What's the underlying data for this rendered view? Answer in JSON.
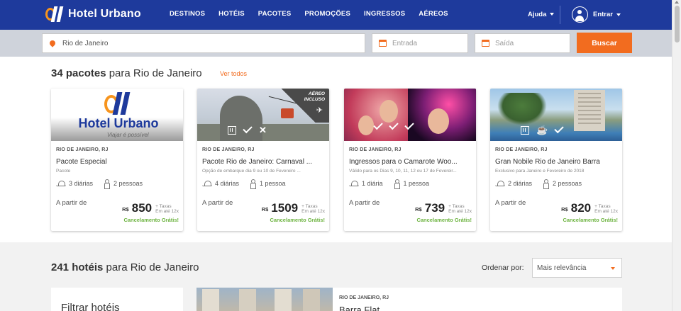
{
  "header": {
    "brand": "Hotel Urbano",
    "nav": [
      "DESTINOS",
      "HOTÉIS",
      "PACOTES",
      "PROMOÇÕES",
      "INGRESSOS",
      "AÉREOS"
    ],
    "help": "Ajuda",
    "login": "Entrar"
  },
  "search": {
    "destination": "Rio de Janeiro",
    "checkin_placeholder": "Entrada",
    "checkout_placeholder": "Saída",
    "button": "Buscar"
  },
  "packages": {
    "count": "34 pacotes",
    "title_rest": " para Rio de Janeiro",
    "see_all": "Ver todos",
    "cards": [
      {
        "location": "RIO DE JANEIRO, RJ",
        "title": "Pacote Especial",
        "subtitle": "Pacote",
        "nights": "3 diárias",
        "people": "2 pessoas",
        "from": "A partir de",
        "currency": "R$",
        "price": "850",
        "tax1": "+ Taxas",
        "tax2": "Em até 12x",
        "cancel": "Cancelamento Grátis!",
        "logo_name": "Hotel Urbano",
        "logo_tag": "Viajar é possível"
      },
      {
        "location": "RIO DE JANEIRO, RJ",
        "title": "Pacote Rio de Janeiro: Carnaval ...",
        "subtitle": "Opção de embarque dia 9 ou 10 de Fevereiro ...",
        "nights": "4 diárias",
        "people": "1 pessoa",
        "from": "A partir de",
        "currency": "R$",
        "price": "1509",
        "tax1": "+ Taxas",
        "tax2": "Em até 12x",
        "cancel": "Cancelamento Grátis!",
        "badge_line1": "AÉREO",
        "badge_line2": "INCLUSO"
      },
      {
        "location": "RIO DE JANEIRO, RJ",
        "title": "Ingressos para o Camarote Woo...",
        "subtitle": "Válido para os Dias 9, 10, 11, 12 ou 17 de Fevereir...",
        "nights": "1 diária",
        "people": "1 pessoa",
        "from": "A partir de",
        "currency": "R$",
        "price": "739",
        "tax1": "+ Taxas",
        "tax2": "Em até 12x",
        "cancel": "Cancelamento Grátis!"
      },
      {
        "location": "RIO DE JANEIRO, RJ",
        "title": "Gran Nobile Rio de Janeiro Barra",
        "subtitle": "Exclusivo para Janeiro e Fevereiro de 2018",
        "nights": "2 diárias",
        "people": "2 pessoas",
        "from": "A partir de",
        "currency": "R$",
        "price": "820",
        "tax1": "+ Taxas",
        "tax2": "Em até 12x",
        "cancel": "Cancelamento Grátis!"
      }
    ]
  },
  "hotels": {
    "count": "241 hotéis",
    "title_rest": " para Rio de Janeiro",
    "sort_label": "Ordenar por:",
    "sort_value": "Mais relevância",
    "filter_title": "Filtrar hotéis",
    "first": {
      "location": "RIO DE JANEIRO, RJ",
      "name": "Barra Flat"
    }
  },
  "colors": {
    "header": "#1e3a9c",
    "accent": "#f26c1f",
    "cancel": "#6cb33f"
  }
}
